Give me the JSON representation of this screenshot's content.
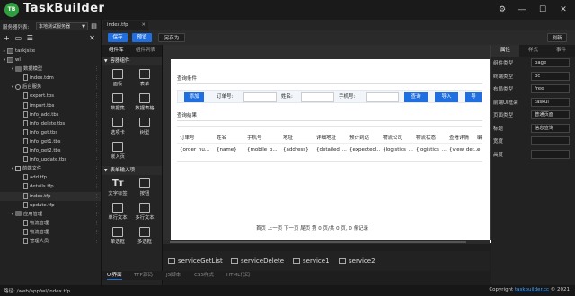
{
  "app": {
    "logo_text": "TB",
    "title": "TaskBuilder"
  },
  "server": {
    "label": "服务器列表:",
    "selected": "本地测试服务器"
  },
  "tree": [
    {
      "label": "taskjsite",
      "indent": 0,
      "twisty": "▸",
      "icon": "proj"
    },
    {
      "label": "wl",
      "indent": 0,
      "twisty": "▾",
      "icon": "proj"
    },
    {
      "label": "数据模型",
      "indent": 1,
      "twisty": "▾",
      "icon": "fold",
      "menu": true
    },
    {
      "label": "index.tdm",
      "indent": 2,
      "twisty": "",
      "icon": "file",
      "menu": true
    },
    {
      "label": "后台服务",
      "indent": 1,
      "twisty": "▾",
      "icon": "gear",
      "menu": true
    },
    {
      "label": "export.tbs",
      "indent": 2,
      "twisty": "",
      "icon": "file",
      "menu": true
    },
    {
      "label": "import.tbs",
      "indent": 2,
      "twisty": "",
      "icon": "file",
      "menu": true
    },
    {
      "label": "info_add.tbs",
      "indent": 2,
      "twisty": "",
      "icon": "file",
      "menu": true
    },
    {
      "label": "info_delete.tbs",
      "indent": 2,
      "twisty": "",
      "icon": "file",
      "menu": true
    },
    {
      "label": "info_get.tbs",
      "indent": 2,
      "twisty": "",
      "icon": "file",
      "menu": true
    },
    {
      "label": "info_get1.tbs",
      "indent": 2,
      "twisty": "",
      "icon": "file",
      "menu": true
    },
    {
      "label": "info_get2.tbs",
      "indent": 2,
      "twisty": "",
      "icon": "file",
      "menu": true
    },
    {
      "label": "info_update.tbs",
      "indent": 2,
      "twisty": "",
      "icon": "file",
      "menu": true
    },
    {
      "label": "前端文件",
      "indent": 1,
      "twisty": "▾",
      "icon": "box",
      "menu": true
    },
    {
      "label": "add.tfp",
      "indent": 2,
      "twisty": "",
      "icon": "file",
      "menu": true
    },
    {
      "label": "details.tfp",
      "indent": 2,
      "twisty": "",
      "icon": "file",
      "menu": true
    },
    {
      "label": "index.tfp",
      "indent": 2,
      "twisty": "",
      "icon": "file",
      "menu": true,
      "selected": true
    },
    {
      "label": "update.tfp",
      "indent": 2,
      "twisty": "",
      "icon": "file",
      "menu": true
    },
    {
      "label": "应用管理",
      "indent": 1,
      "twisty": "▾",
      "icon": "fold",
      "menu": true
    },
    {
      "label": "物流管理",
      "indent": 2,
      "twisty": "",
      "icon": "file",
      "menu": true
    },
    {
      "label": "物流管理",
      "indent": 2,
      "twisty": "",
      "icon": "file",
      "menu": true
    },
    {
      "label": "管理人员",
      "indent": 2,
      "twisty": "",
      "icon": "file",
      "menu": true
    }
  ],
  "file_tab": {
    "name": "index.tfp"
  },
  "toolbar": {
    "save": "保存",
    "preview": "预览",
    "save_as": "另存为",
    "refresh": "刷新"
  },
  "components": {
    "tabs": [
      "组件库",
      "组件列表"
    ],
    "group_container": "容器组件",
    "container_items": [
      "面板",
      "表单",
      "数据集",
      "数据表格",
      "选项卡",
      "树型",
      "嵌入页"
    ],
    "group_form": "表单输入项",
    "form_items": [
      {
        "label": "文字标签",
        "glyph": "Tт"
      },
      {
        "label": "按钮",
        "glyph": ""
      },
      {
        "label": "单行文本",
        "glyph": ""
      },
      {
        "label": "多行文本",
        "glyph": ""
      },
      {
        "label": "单选框",
        "glyph": ""
      },
      {
        "label": "多选框",
        "glyph": ""
      }
    ]
  },
  "canvas": {
    "condition_title": "查询条件",
    "add_button": "添加",
    "fields": [
      "订单号:",
      "姓名:",
      "手机号:"
    ],
    "query_button": "查询",
    "import_button": "导入",
    "export_button": "导",
    "result_title": "查询结果",
    "columns": [
      "订单号",
      "姓名",
      "手机号",
      "地址",
      "详细地址",
      "预计到达",
      "物流公司",
      "物流状态",
      "查看详情",
      "编"
    ],
    "row": [
      "{order_nu...",
      "{name}",
      "{mobile_p...",
      "{address}",
      "{detailed_...",
      "{expected...",
      "{logistics_...",
      "{logistics_...",
      "{view_det...",
      "e"
    ],
    "pager": "首页  上一页  下一页  尾页  第 0 页/共 0 页, 0 条记录"
  },
  "services": [
    "serviceGetList",
    "serviceDelete",
    "service1",
    "service2"
  ],
  "view_tabs": [
    "UI界面",
    "TFP源码",
    "JS脚本",
    "CSS样式",
    "HTML代码"
  ],
  "props": {
    "tabs": [
      "属性",
      "样式",
      "事件"
    ],
    "rows": [
      {
        "label": "组件类型",
        "value": "page"
      },
      {
        "label": "终端类型",
        "value": "pc"
      },
      {
        "label": "布局类型",
        "value": "free"
      },
      {
        "label": "前端UI框架",
        "value": "taskui"
      },
      {
        "label": "页面类型",
        "value": "普通页面"
      },
      {
        "label": "标题",
        "value": "信息查询"
      },
      {
        "label": "宽度",
        "value": ""
      },
      {
        "label": "高度",
        "value": ""
      }
    ]
  },
  "status": {
    "path": "路径: /web/app/wl/index.tfp",
    "copyright_prefix": "Copyright ",
    "copyright_link": "taskbuilder.cc",
    "copyright_suffix": " © 2021"
  },
  "colors": {
    "accent": "#1f6fe0",
    "logo": "#2e9e3e",
    "background": "#1e1e1e"
  }
}
